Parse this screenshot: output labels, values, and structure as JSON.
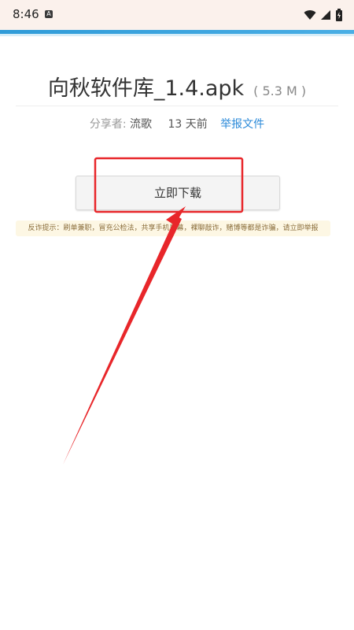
{
  "status_bar": {
    "time": "8:46",
    "notification_icon": "a-notification-icon",
    "icons": [
      "wifi-icon",
      "signal-icon",
      "battery-icon"
    ]
  },
  "file": {
    "name": "向秋软件库_1.4.apk",
    "size": "( 5.3 M )"
  },
  "meta": {
    "sharer_label": "分享者:",
    "sharer_name": "流歌",
    "time_ago": "13 天前",
    "report_link": "举报文件"
  },
  "download_button": {
    "label": "立即下载"
  },
  "warning": {
    "text": "反诈提示：刷单兼职，冒充公检法，共享手机屏幕，裸聊敲诈，赌博等都是诈骗，请立即举报"
  },
  "colors": {
    "accent_blue": "#2f9bd8",
    "link_blue": "#2b8ad9",
    "annotation_red": "#e8262a",
    "warning_bg": "#fdf7e4"
  }
}
